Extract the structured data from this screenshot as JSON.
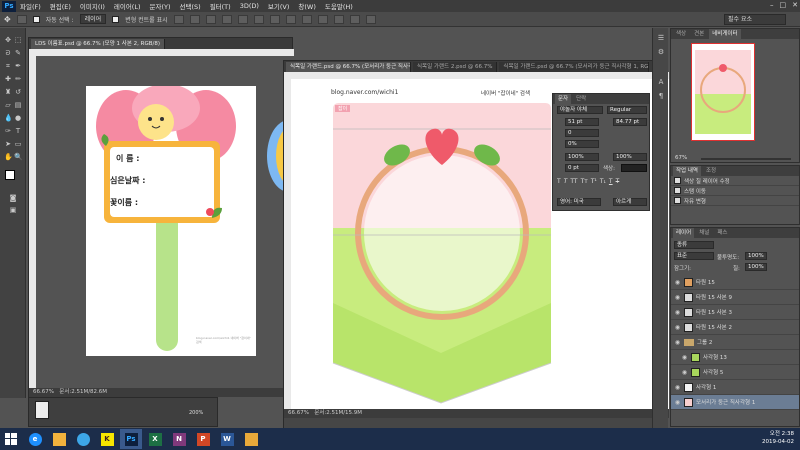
{
  "app": {
    "logo": "Ps",
    "accent": "#31a8ff"
  },
  "menu": [
    "파일(F)",
    "편집(E)",
    "이미지(I)",
    "레이어(L)",
    "문자(Y)",
    "선택(S)",
    "필터(T)",
    "3D(D)",
    "보기(V)",
    "창(W)",
    "도움말(H)"
  ],
  "window_controls": [
    "–",
    "□",
    "✕"
  ],
  "options": {
    "auto_select_label": "자동 선택 :",
    "auto_select_value": "레이어",
    "show_transform_label": "변형 컨트롤 표시",
    "workspace": "필수 요소"
  },
  "doc1": {
    "tab": "LDS 이름표.psd @ 66.7% (모양 1 사본 2, RGB/8)",
    "status_zoom": "66.67%",
    "status_doc": "문서:2.51M/82.6M",
    "card": {
      "name_label": "이  름 :",
      "date_label": "심은날짜 :",
      "flower_label": "꽃이름 :"
    },
    "tiny_credit": "blog.naver.com/wichi1  네이버 \"잡이네\" 검색",
    "mini_zoom": "200%"
  },
  "doc2": {
    "tabs": [
      "식목일 가랜드.psd @ 66.7% (모서리가 둥근 직사각형 1, RGB/8)",
      "식목일 가랜드 2.psd @ 66.7%",
      "식목일 가랜드.psd @ 66.7% (모서리가 둥근 직사각형 1, RGB/8)"
    ],
    "blog": "blog.naver.com/wichi1",
    "search_hint": "네이버 \"잡이네\" 검색",
    "corner_tag": "잡이",
    "status_zoom": "66.67%",
    "status_doc": "문서:2.51M/15.9M"
  },
  "character": {
    "tabs": [
      "문자",
      "단락"
    ],
    "font": "야놀자 야체",
    "style": "Regular",
    "size": "51 pt",
    "leading": "84.77 pt",
    "tracking": "0",
    "kerning": "0%",
    "scale_v": "100%",
    "scale_h": "100%",
    "baseline": "0 pt",
    "color_label": "색상:",
    "lang": "영어: 미국",
    "aa": "아르게"
  },
  "nav": {
    "tabs": [
      "색상",
      "견본",
      "네비게이터"
    ],
    "zoom": "67%"
  },
  "history": {
    "tabs": [
      "작업 내역",
      "조정"
    ],
    "items": [
      "색상 칠 레이어 수정",
      "스탬 이동",
      "자유 변형"
    ]
  },
  "layers": {
    "tabs": [
      "레이어",
      "채널",
      "패스"
    ],
    "kind": "종류",
    "blend": "표준",
    "opacity_label": "불투명도:",
    "opacity": "100%",
    "lock_label": "잠그기:",
    "fill_label": "칠:",
    "fill": "100%",
    "items": [
      {
        "name": "타원 15",
        "type": "shape",
        "thumb": "#e0a060"
      },
      {
        "name": "타원 15 사본 9",
        "type": "shape",
        "thumb": "#ddd"
      },
      {
        "name": "타원 15 사본 3",
        "type": "shape",
        "thumb": "#ddd"
      },
      {
        "name": "타원 15 사본 2",
        "type": "shape",
        "thumb": "#ddd"
      },
      {
        "name": "그룹 2",
        "type": "group",
        "thumb": ""
      },
      {
        "name": "사각형 13",
        "type": "shape",
        "thumb": "#a8d65c"
      },
      {
        "name": "사각형 5",
        "type": "shape",
        "thumb": "#a8d65c"
      },
      {
        "name": "사각형 1",
        "type": "shape",
        "thumb": "#f4f4f4"
      },
      {
        "name": "모서리가 둥근 직사각형 1",
        "type": "shape",
        "thumb": "#f8d0d0",
        "selected": true
      }
    ]
  },
  "taskbar": {
    "apps": [
      {
        "label": "",
        "color": "#2d89ef",
        "icon": "start"
      },
      {
        "label": "e",
        "color": "#1e90ff"
      },
      {
        "label": "",
        "color": "#f2b33d"
      },
      {
        "label": "",
        "color": "#3da7e8"
      },
      {
        "label": "K",
        "color": "#f7e600"
      },
      {
        "label": "Ps",
        "color": "#0d1f3c"
      },
      {
        "label": "X",
        "color": "#1d7044"
      },
      {
        "label": "N",
        "color": "#80397b"
      },
      {
        "label": "P",
        "color": "#d24726"
      },
      {
        "label": "W",
        "color": "#2b5797"
      },
      {
        "label": "",
        "color": "#e8a93a"
      }
    ],
    "time": "오전 2:38",
    "date": "2019-04-02"
  }
}
